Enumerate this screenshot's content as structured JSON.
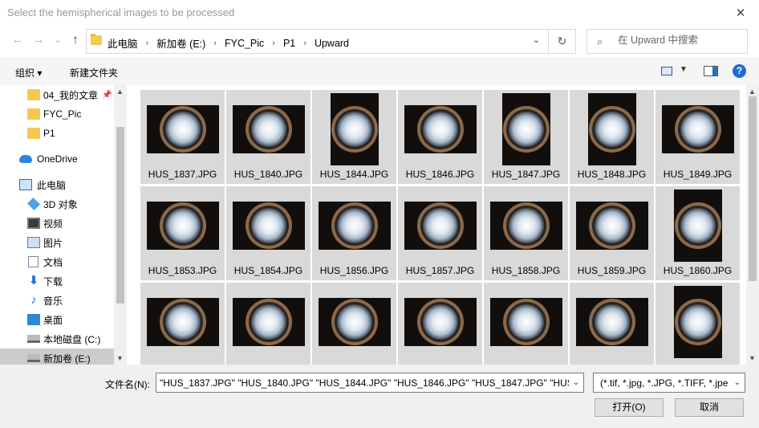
{
  "window": {
    "title": "Select the hemispherical images to be processed",
    "close": "✕"
  },
  "nav": {
    "back": "←",
    "forward": "→",
    "recent": "⌄",
    "up": "↑"
  },
  "address": {
    "crumbs": [
      "此电脑",
      "新加卷 (E:)",
      "FYC_Pic",
      "P1",
      "Upward"
    ],
    "dropdown": "⌄",
    "refresh": "↻"
  },
  "search": {
    "placeholder": "在 Upward 中搜索",
    "icon": "⌕"
  },
  "toolbar": {
    "organize": "组织 ▾",
    "new_folder": "新建文件夹",
    "help": "?"
  },
  "sidebar": {
    "items": [
      {
        "label": "04_我的文章",
        "icon": "folder-icon",
        "pinned": true
      },
      {
        "label": "FYC_Pic",
        "icon": "folder-icon"
      },
      {
        "label": "P1",
        "icon": "folder-icon"
      },
      {
        "label": "OneDrive",
        "icon": "cloud-icon"
      },
      {
        "label": "此电脑",
        "icon": "computer-icon"
      },
      {
        "label": "3D 对象",
        "icon": "3d-objects-icon"
      },
      {
        "label": "视频",
        "icon": "video-icon"
      },
      {
        "label": "图片",
        "icon": "pictures-icon"
      },
      {
        "label": "文档",
        "icon": "documents-icon"
      },
      {
        "label": "下载",
        "icon": "downloads-icon"
      },
      {
        "label": "音乐",
        "icon": "music-icon"
      },
      {
        "label": "桌面",
        "icon": "desktop-icon"
      },
      {
        "label": "本地磁盘 (C:)",
        "icon": "drive-icon"
      },
      {
        "label": "新加卷 (E:)",
        "icon": "drive-icon",
        "selected": true
      }
    ]
  },
  "files": [
    {
      "name": "HUS_1837.JPG",
      "orientation": "landscape"
    },
    {
      "name": "HUS_1840.JPG",
      "orientation": "landscape"
    },
    {
      "name": "HUS_1844.JPG",
      "orientation": "portrait"
    },
    {
      "name": "HUS_1846.JPG",
      "orientation": "landscape"
    },
    {
      "name": "HUS_1847.JPG",
      "orientation": "portrait"
    },
    {
      "name": "HUS_1848.JPG",
      "orientation": "portrait"
    },
    {
      "name": "HUS_1849.JPG",
      "orientation": "landscape"
    },
    {
      "name": "HUS_1853.JPG",
      "orientation": "landscape"
    },
    {
      "name": "HUS_1854.JPG",
      "orientation": "landscape"
    },
    {
      "name": "HUS_1856.JPG",
      "orientation": "landscape"
    },
    {
      "name": "HUS_1857.JPG",
      "orientation": "landscape"
    },
    {
      "name": "HUS_1858.JPG",
      "orientation": "landscape"
    },
    {
      "name": "HUS_1859.JPG",
      "orientation": "landscape"
    },
    {
      "name": "HUS_1860.JPG",
      "orientation": "portrait"
    },
    {
      "name": "",
      "orientation": "landscape"
    },
    {
      "name": "",
      "orientation": "landscape"
    },
    {
      "name": "",
      "orientation": "landscape"
    },
    {
      "name": "",
      "orientation": "landscape"
    },
    {
      "name": "",
      "orientation": "landscape"
    },
    {
      "name": "",
      "orientation": "landscape"
    },
    {
      "name": "",
      "orientation": "portrait"
    }
  ],
  "footer": {
    "filename_label": "文件名(N):",
    "filename_value": "\"HUS_1837.JPG\" \"HUS_1840.JPG\" \"HUS_1844.JPG\" \"HUS_1846.JPG\" \"HUS_1847.JPG\" \"HUS_",
    "filter_value": "(*.tif, *.jpg, *.JPG, *.TIFF, *.jpe",
    "open_label": "打开(O)",
    "cancel_label": "取消"
  }
}
